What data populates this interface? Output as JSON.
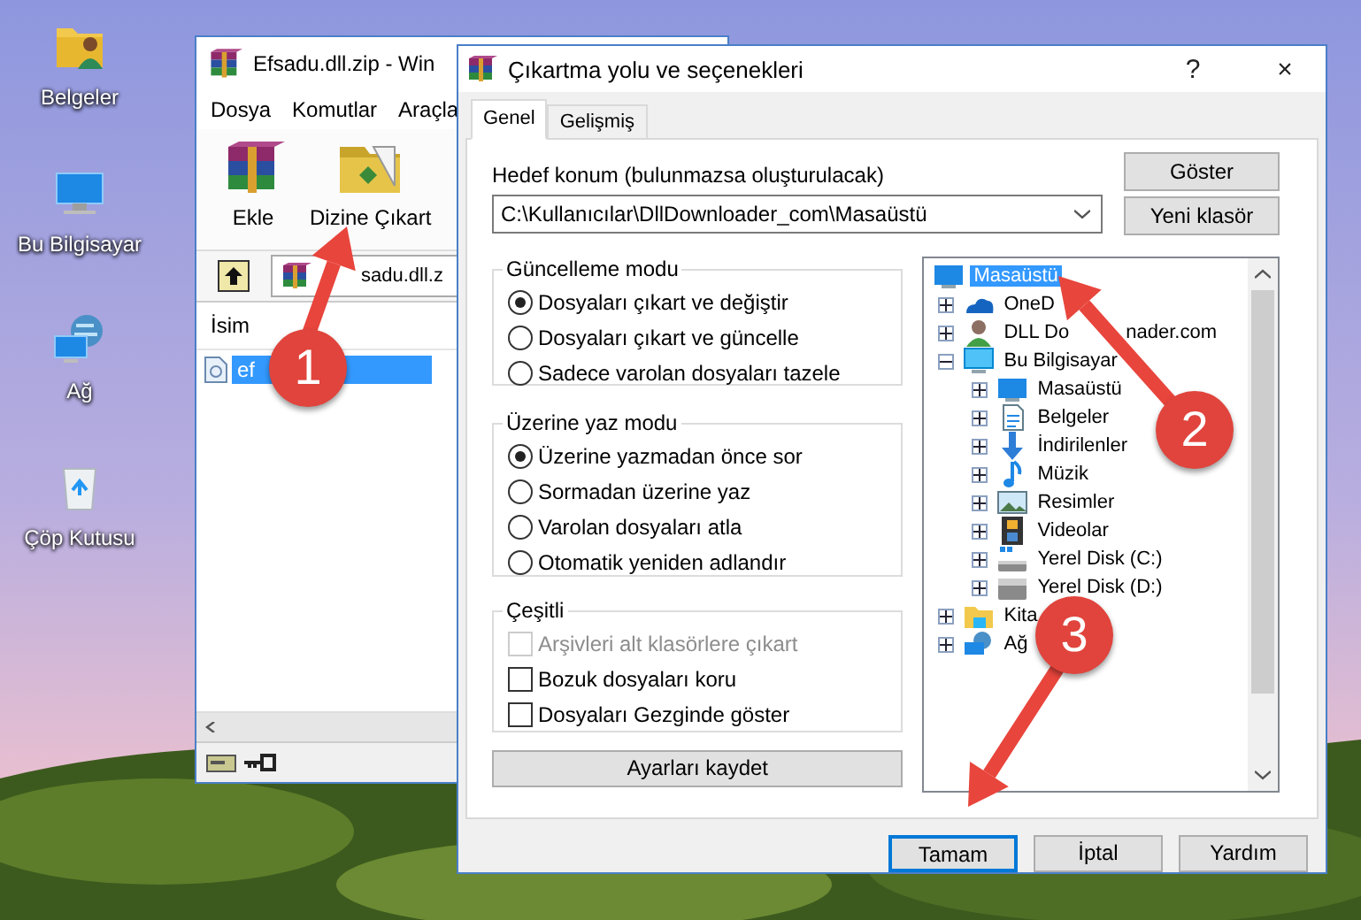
{
  "desktop_icons": [
    {
      "label": "Belgeler"
    },
    {
      "label": "Bu Bilgisayar"
    },
    {
      "label": "Ağ"
    },
    {
      "label": "Çöp Kutusu"
    }
  ],
  "archive_window": {
    "title": "Efsadu.dll.zip - Win",
    "menu": [
      "Dosya",
      "Komutlar",
      "Araçla"
    ],
    "toolbar": [
      {
        "label": "Ekle"
      },
      {
        "label": "Dizine Çıkart"
      }
    ],
    "address": "sadu.dll.z",
    "columns": [
      "İsim"
    ],
    "files": [
      {
        "name": "ef",
        "selected": true
      }
    ]
  },
  "dialog": {
    "title": "Çıkartma yolu ve seçenekleri",
    "help": "?",
    "close": "×",
    "tabs": [
      {
        "label": "Genel",
        "selected": true
      },
      {
        "label": "Gelişmiş",
        "selected": false
      }
    ],
    "destination_label": "Hedef konum (bulunmazsa oluşturulacak)",
    "destination": "C:\\Kullanıcılar\\DllDownloader_com\\Masaüstü",
    "side_buttons": [
      "Göster",
      "Yeni klasör"
    ],
    "groups": [
      {
        "title": "Güncelleme modu",
        "kind": "radio",
        "options": [
          {
            "label": "Dosyaları çıkart ve değiştir",
            "selected": true
          },
          {
            "label": "Dosyaları çıkart ve güncelle",
            "selected": false
          },
          {
            "label": "Sadece varolan dosyaları tazele",
            "selected": false
          }
        ]
      },
      {
        "title": "Üzerine yaz modu",
        "kind": "radio",
        "options": [
          {
            "label": "Üzerine yazmadan önce sor",
            "selected": true
          },
          {
            "label": "Sormadan üzerine yaz",
            "selected": false
          },
          {
            "label": "Varolan dosyaları atla",
            "selected": false
          },
          {
            "label": "Otomatik yeniden adlandır",
            "selected": false
          }
        ]
      },
      {
        "title": "Çeşitli",
        "kind": "checkbox",
        "options": [
          {
            "label": "Arşivleri alt klasörlere çıkart",
            "checked": false,
            "disabled": true
          },
          {
            "label": "Bozuk dosyaları koru",
            "checked": false,
            "disabled": false
          },
          {
            "label": "Dosyaları Gezginde göster",
            "checked": false,
            "disabled": false
          }
        ]
      }
    ],
    "save_button": "Ayarları kaydet",
    "tree": [
      {
        "label": "Masaüstü",
        "selected": true,
        "children": [
          {
            "label": "OneD",
            "selected": false,
            "expanded": false
          },
          {
            "label": "DLL Do",
            "tail": "nader.com",
            "selected": false,
            "expanded": false
          },
          {
            "label": "Bu Bilgisayar",
            "selected": false,
            "expanded": true,
            "children": [
              {
                "label": "Masaüstü",
                "selected": false,
                "expanded": false
              },
              {
                "label": "Belgeler",
                "selected": false,
                "expanded": false
              },
              {
                "label": "İndirilenler",
                "selected": false,
                "expanded": false
              },
              {
                "label": "Müzik",
                "selected": false,
                "expanded": false
              },
              {
                "label": "Resimler",
                "selected": false,
                "expanded": false
              },
              {
                "label": "Videolar",
                "selected": false,
                "expanded": false
              },
              {
                "label": "Yerel Disk (C:)",
                "selected": false,
                "expanded": false
              },
              {
                "label": "Yerel Disk (D:)",
                "selected": false,
                "expanded": false
              }
            ]
          },
          {
            "label": "Kita",
            "selected": false,
            "expanded": false
          },
          {
            "label": "Ağ",
            "selected": false,
            "expanded": false
          }
        ]
      }
    ],
    "buttons": [
      {
        "label": "Tamam",
        "default": true
      },
      {
        "label": "İptal",
        "default": false
      },
      {
        "label": "Yardım",
        "default": false
      }
    ]
  },
  "annotations": [
    {
      "label": "1"
    },
    {
      "label": "2"
    },
    {
      "label": "3"
    }
  ]
}
